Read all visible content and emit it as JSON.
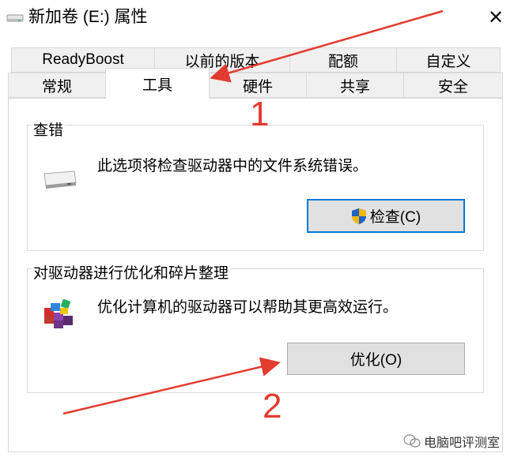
{
  "window": {
    "title": "新加卷 (E:) 属性",
    "close_glyph": "✕"
  },
  "tabs": {
    "row1": [
      {
        "label": "ReadyBoost"
      },
      {
        "label": "以前的版本"
      },
      {
        "label": "配额"
      },
      {
        "label": "自定义"
      }
    ],
    "row2": [
      {
        "label": "常规"
      },
      {
        "label": "工具",
        "active": true
      },
      {
        "label": "硬件"
      },
      {
        "label": "共享"
      },
      {
        "label": "安全"
      }
    ]
  },
  "check_group": {
    "title": "查错",
    "description": "此选项将检查驱动器中的文件系统错误。",
    "button_label": "检查(C)",
    "icon": "drive-icon",
    "button_icon": "uac-shield-icon"
  },
  "optimize_group": {
    "title": "对驱动器进行优化和碎片整理",
    "description": "优化计算机的驱动器可以帮助其更高效运行。",
    "button_label": "优化(O)",
    "icon": "defrag-icon"
  },
  "annotations": {
    "number_1": "1",
    "number_2": "2",
    "arrow_color": "#e23b2f"
  },
  "watermark": {
    "text": "电脑吧评测室"
  }
}
